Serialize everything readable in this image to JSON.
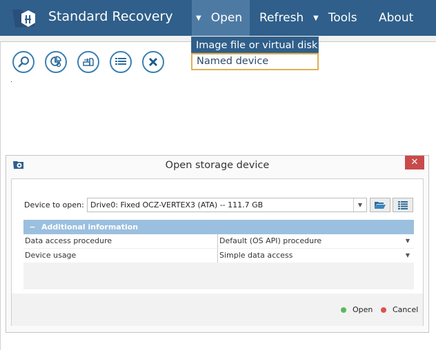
{
  "app": {
    "title": "Standard Recovery"
  },
  "nav": {
    "open": "Open",
    "refresh": "Refresh",
    "tools": "Tools",
    "about": "About"
  },
  "open_menu": {
    "items": [
      "Image file or virtual disk",
      "Named device"
    ]
  },
  "toolbar": {
    "icons": [
      "search-scan-icon",
      "partition-search-icon",
      "transfer-icon",
      "list-icon",
      "close-icon"
    ]
  },
  "dialog": {
    "title": "Open storage device",
    "close": "✕",
    "device_label": "Device to open:",
    "device_value": "Drive0: Fixed OCZ-VERTEX3 (ATA) -- 111.7 GB",
    "section_title": "Additional information",
    "section_toggle": "−",
    "properties": [
      {
        "name": "Data access procedure",
        "value": "Default (OS API) procedure"
      },
      {
        "name": "Device usage",
        "value": "Simple data access"
      }
    ],
    "buttons": {
      "open": "Open",
      "cancel": "Cancel"
    },
    "colors": {
      "open": "#5cb85c",
      "cancel": "#d9534f",
      "close_bg": "#c94a4a"
    }
  }
}
